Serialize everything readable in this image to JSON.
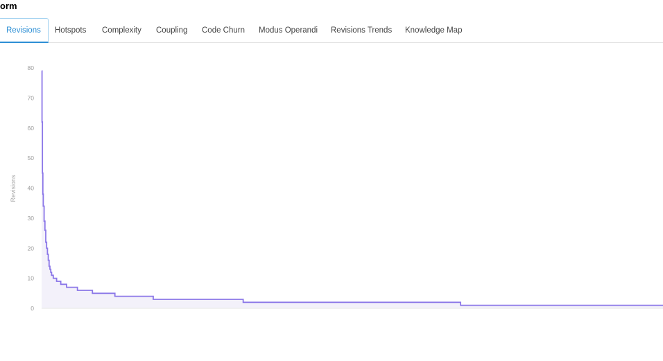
{
  "header": {
    "title": "orm"
  },
  "tabs": [
    {
      "label": "Revisions",
      "active": true
    },
    {
      "label": "Hotspots"
    },
    {
      "label": "Complexity"
    },
    {
      "label": "Coupling"
    },
    {
      "label": "Code Churn"
    },
    {
      "label": "Modus Operandi"
    },
    {
      "label": "Revisions Trends"
    },
    {
      "label": "Knowledge Map"
    }
  ],
  "colors": {
    "accent": "#2d8fd5",
    "series": "#8b77e8",
    "area": "#f3f1fa"
  },
  "chart_data": {
    "type": "area",
    "ylabel": "Revisions",
    "xlabel": "",
    "ylim": [
      0,
      80
    ],
    "yticks": [
      0,
      10,
      20,
      30,
      40,
      50,
      60,
      70,
      80
    ],
    "grid": false,
    "series": [
      {
        "points": [
          [
            0,
            79
          ],
          [
            0.5,
            62
          ],
          [
            1,
            45
          ],
          [
            1.5,
            38
          ],
          [
            2,
            34
          ],
          [
            3,
            29
          ],
          [
            4,
            26
          ],
          [
            5,
            22
          ],
          [
            6,
            20
          ],
          [
            7,
            18
          ],
          [
            8,
            16
          ],
          [
            9,
            14
          ],
          [
            10,
            13
          ],
          [
            11,
            12
          ],
          [
            12,
            11
          ],
          [
            13,
            11
          ],
          [
            14,
            10
          ],
          [
            17,
            10
          ],
          [
            18,
            9
          ],
          [
            22,
            9
          ],
          [
            23,
            8
          ],
          [
            29,
            8
          ],
          [
            30,
            7
          ],
          [
            42,
            7
          ],
          [
            43,
            6
          ],
          [
            60,
            6
          ],
          [
            61,
            5
          ],
          [
            87,
            5
          ],
          [
            88,
            4
          ],
          [
            133,
            4
          ],
          [
            134,
            3
          ],
          [
            241,
            3
          ],
          [
            242,
            2
          ],
          [
            502,
            2
          ],
          [
            503,
            1
          ],
          [
            746,
            1
          ]
        ]
      }
    ]
  }
}
